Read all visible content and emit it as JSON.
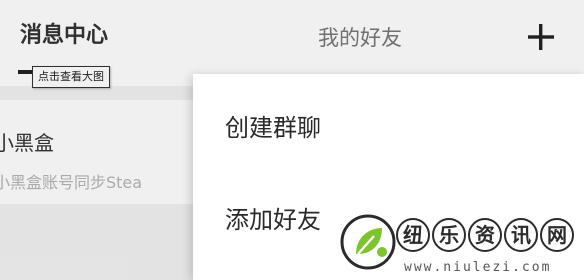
{
  "header": {
    "tab_messages": "消息中心",
    "tab_friends": "我的好友",
    "add_icon": "plus-icon"
  },
  "tooltip": {
    "text": "点击查看大图"
  },
  "conversation": {
    "name": "小黑盒",
    "preview": "小黑盒账号同步Stea"
  },
  "menu": {
    "items": [
      {
        "label": "创建群聊"
      },
      {
        "label": "添加好友"
      }
    ]
  },
  "watermark": {
    "chars": [
      "纽",
      "乐",
      "资",
      "讯",
      "网"
    ],
    "url": "www.niulezi.com",
    "colors": {
      "logo_green": "#7cc32e",
      "text": "#2b2b2b"
    }
  }
}
